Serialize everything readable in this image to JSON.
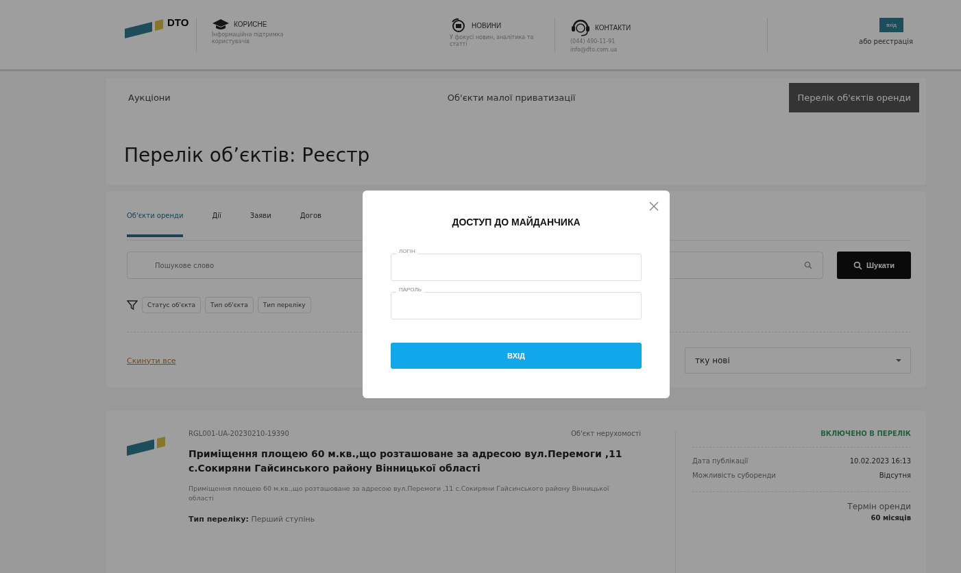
{
  "header": {
    "logo_text": "DTO",
    "links": [
      {
        "kind": "cap",
        "title": "КОРИСНЕ",
        "lines": [
          "Інформаційна підтримка користувачів"
        ]
      },
      {
        "kind": "news",
        "title": "НОВИНИ",
        "lines": [
          "У фокусі новин, аналітика та статті"
        ]
      },
      {
        "kind": "headset",
        "title": "КОНТАКТИ",
        "lines": [
          "(044) 490-11-91",
          "info@dto.com.ua"
        ]
      }
    ],
    "login_button": "вхід",
    "register_link": "або реєстрація"
  },
  "nav": [
    {
      "label": "Аукціони",
      "selected": false
    },
    {
      "label": "Об'єкти малої приватизації",
      "selected": false
    },
    {
      "label": "Перелік об'єктів оренди",
      "selected": true
    }
  ],
  "page_title": "Перелік об’єктів: Реєстр",
  "tabs": [
    {
      "label": "Об'єкти оренди",
      "selected": true
    },
    {
      "label": "Дії",
      "selected": false
    },
    {
      "label": "Заяви",
      "selected": false
    },
    {
      "label": "Догов",
      "selected": false
    }
  ],
  "search": {
    "placeholder": "Пошукове слово",
    "button": "Шукати"
  },
  "filters": [
    "Статус об'єкта",
    "Тип об'єкта",
    "Тип переліку"
  ],
  "reset_link": "Скинути все",
  "sort": {
    "value": "тку нові"
  },
  "result": {
    "id": "RGL001-UA-20230210-19390",
    "type": "Об'єкт нерухомості",
    "title": "Приміщення площею 60 м.кв.,що розташоване за адресою вул.Перемоги ,11 с.Сокиряни Гайсинського району Вінницької області",
    "description": "Приміщення площею 60 м.кв.,що розташоване за адресою вул.Перемоги ,11 с.Сокиряни Гайсинського району Вінницької області",
    "list_type_label": "Тип переліку:",
    "list_type": "Перший ступінь",
    "status": "ВКЛЮЧЕНО В ПЕРЕЛІК",
    "facts": [
      {
        "label": "Дата публікації",
        "value": "10.02.2023 16:13"
      },
      {
        "label": "Можливість суборенди",
        "value": "Відсутня"
      }
    ],
    "term_label": "Термін оренди",
    "term_value": "60 місяців"
  },
  "modal": {
    "title": "ДОСТУП ДО МАЙДАНЧИКА",
    "fields": [
      {
        "label": "ЛОГІН"
      },
      {
        "label": "ПАРОЛЬ"
      }
    ],
    "submit": "ВХІД"
  }
}
